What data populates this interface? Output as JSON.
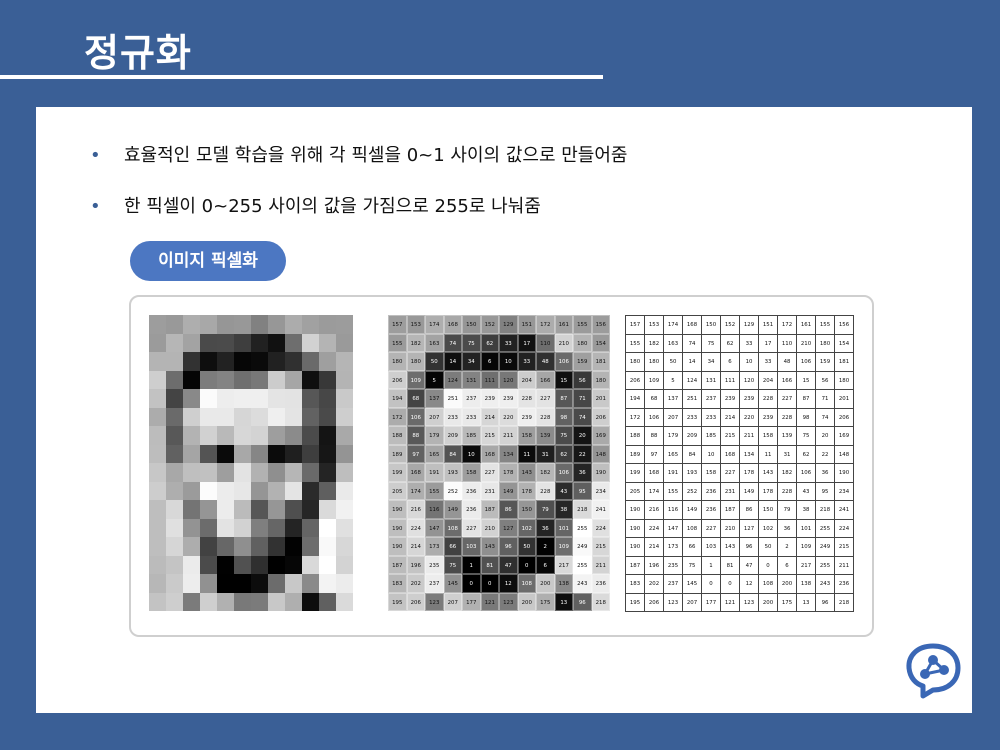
{
  "title": "정규화",
  "bullets": [
    "효율적인 모델 학습을 위해 각 픽셀을 0~1 사이의 값으로 만들어줌",
    "한 픽셀이 0~255 사이의 값을 가짐으로 255로 나눠줌"
  ],
  "pill_label": "이미지 픽셀화",
  "colors": {
    "background": "#3a5f96",
    "pill": "#4c77c2",
    "bullet": "#3a5f96"
  },
  "logo_icon": "brain-network-icon",
  "pixel_grid": [
    [
      157,
      153,
      174,
      168,
      150,
      152,
      129,
      151,
      172,
      161,
      155,
      156
    ],
    [
      155,
      182,
      163,
      74,
      75,
      62,
      33,
      17,
      110,
      210,
      180,
      154
    ],
    [
      180,
      180,
      50,
      14,
      34,
      6,
      10,
      33,
      48,
      106,
      159,
      181
    ],
    [
      206,
      109,
      5,
      124,
      131,
      111,
      120,
      204,
      166,
      15,
      56,
      180
    ],
    [
      194,
      68,
      137,
      251,
      237,
      239,
      239,
      228,
      227,
      87,
      71,
      201
    ],
    [
      172,
      106,
      207,
      233,
      233,
      214,
      220,
      239,
      228,
      98,
      74,
      206
    ],
    [
      188,
      88,
      179,
      209,
      185,
      215,
      211,
      158,
      139,
      75,
      20,
      169
    ],
    [
      189,
      97,
      165,
      84,
      10,
      168,
      134,
      11,
      31,
      62,
      22,
      148
    ],
    [
      199,
      168,
      191,
      193,
      158,
      227,
      178,
      143,
      182,
      106,
      36,
      190
    ],
    [
      205,
      174,
      155,
      252,
      236,
      231,
      149,
      178,
      228,
      43,
      95,
      234
    ],
    [
      190,
      216,
      116,
      149,
      236,
      187,
      86,
      150,
      79,
      38,
      218,
      241
    ],
    [
      190,
      224,
      147,
      108,
      227,
      210,
      127,
      102,
      36,
      101,
      255,
      224
    ],
    [
      190,
      214,
      173,
      66,
      103,
      143,
      96,
      50,
      2,
      109,
      249,
      215
    ],
    [
      187,
      196,
      235,
      75,
      1,
      81,
      47,
      0,
      6,
      217,
      255,
      211
    ],
    [
      183,
      202,
      237,
      145,
      0,
      0,
      12,
      108,
      200,
      138,
      243,
      236
    ],
    [
      195,
      206,
      123,
      207,
      177,
      121,
      123,
      200,
      175,
      13,
      96,
      218
    ]
  ]
}
